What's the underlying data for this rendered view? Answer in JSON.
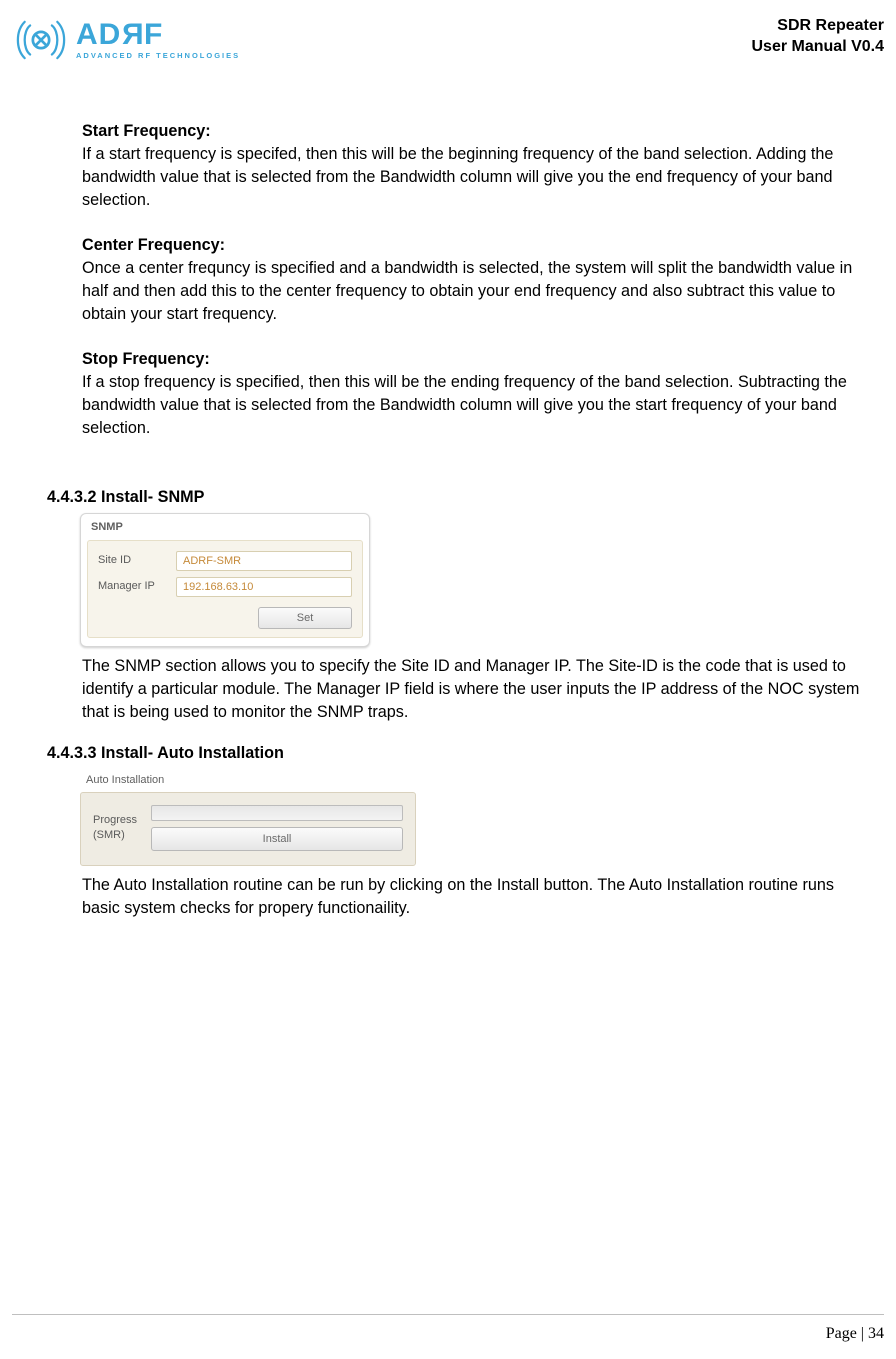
{
  "header": {
    "logo": {
      "adrf": "ADRF",
      "tagline": "ADVANCED RF TECHNOLOGIES"
    },
    "title_line1": "SDR Repeater",
    "title_line2": "User Manual V0.4"
  },
  "body": {
    "start_freq_title": "Start Frequency:",
    "start_freq_body": "If a start frequency is specifed, then this will be the beginning frequency of the band selection.   Adding the bandwidth value that is selected from the Bandwidth column will give you the end frequency of your band selection.",
    "center_freq_title": "Center Frequency:",
    "center_freq_body": "Once a center frequncy is specified and a bandwidth is selected, the system will split the bandwidth value in half and then add this to the center frequency to obtain your end frequency and also subtract this value to obtain your start frequency.",
    "stop_freq_title": "Stop Frequency:",
    "stop_freq_body": "If a stop frequency is specified, then this will be the ending frequency of the band selection.   Subtracting the bandwidth value that is selected from the Bandwidth column will give you the start frequency of your band selection.",
    "snmp_heading": "4.4.3.2 Install- SNMP",
    "snmp_panel": {
      "title": "SNMP",
      "site_id_label": "Site ID",
      "site_id_value": "ADRF-SMR",
      "manager_ip_label": "Manager IP",
      "manager_ip_value": "192.168.63.10",
      "set_label": "Set"
    },
    "snmp_desc": "The SNMP section allows you to specify the Site ID and Manager IP.   The Site-ID is the code that is used to identify a particular module.   The Manager IP field is where the user inputs the IP address of the NOC system that is being used to monitor the SNMP traps.",
    "auto_heading": "4.4.3.3 Install- Auto Installation",
    "auto_panel": {
      "title": "Auto Installation",
      "progress_line1": "Progress",
      "progress_line2": "(SMR)",
      "install_label": "Install"
    },
    "auto_desc": "The Auto Installation routine can be run by clicking on the Install button.   The Auto Installation routine runs basic system checks for propery functionaility."
  },
  "footer": {
    "page_label": "Page | 34"
  }
}
